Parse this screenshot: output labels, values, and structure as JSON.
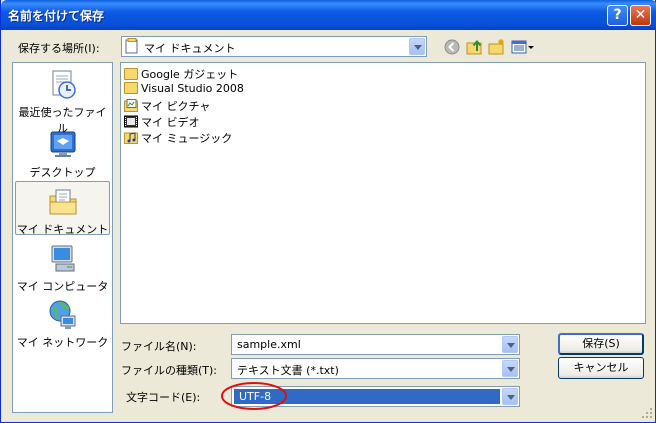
{
  "window": {
    "title": "名前を付けて保存"
  },
  "titlebar_buttons": {
    "help": "?",
    "close": "✕"
  },
  "save_in": {
    "label": "保存する場所(I):",
    "value": "マイ ドキュメント"
  },
  "places": [
    {
      "label": "最近使ったファイル",
      "icon": "recent-documents-icon"
    },
    {
      "label": "デスクトップ",
      "icon": "desktop-icon"
    },
    {
      "label": "マイ ドキュメント",
      "icon": "my-documents-icon",
      "selected": true
    },
    {
      "label": "マイ コンピュータ",
      "icon": "my-computer-icon"
    },
    {
      "label": "マイ ネットワーク",
      "icon": "my-network-icon"
    }
  ],
  "files": [
    {
      "name": "Google ガジェット",
      "icon": "folder-icon"
    },
    {
      "name": "Visual Studio 2008",
      "icon": "folder-icon"
    },
    {
      "name": "マイ ピクチャ",
      "icon": "my-pictures-folder-icon"
    },
    {
      "name": "マイ ビデオ",
      "icon": "my-videos-folder-icon"
    },
    {
      "name": "マイ ミュージック",
      "icon": "my-music-folder-icon"
    }
  ],
  "filename": {
    "label": "ファイル名(N):",
    "value": "sample.xml"
  },
  "filetype": {
    "label": "ファイルの種類(T):",
    "value": "テキスト文書 (*.txt)"
  },
  "encoding": {
    "label": "文字コード(E):",
    "value": "UTF-8"
  },
  "buttons": {
    "save": "保存(S)",
    "cancel": "キャンセル"
  },
  "colors": {
    "titlebar": "#0752DA",
    "highlight": "#316AC5",
    "annotation_circle": "#E01010"
  }
}
